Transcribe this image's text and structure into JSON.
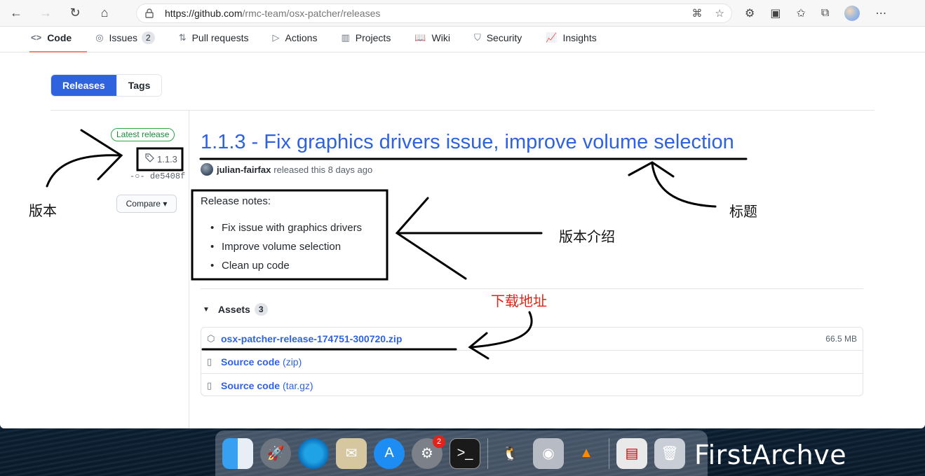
{
  "browser": {
    "url_host": "https://github.com",
    "url_path": "/rmc-team/osx-patcher/releases"
  },
  "repo_nav": [
    {
      "label": "Code",
      "icon": "code-icon",
      "glyph": "<>",
      "active": true
    },
    {
      "label": "Issues",
      "icon": "issue-icon",
      "glyph": "◎",
      "count": "2"
    },
    {
      "label": "Pull requests",
      "icon": "pull-request-icon",
      "glyph": "⇅"
    },
    {
      "label": "Actions",
      "icon": "play-icon",
      "glyph": "▷"
    },
    {
      "label": "Projects",
      "icon": "project-icon",
      "glyph": "▥"
    },
    {
      "label": "Wiki",
      "icon": "book-icon",
      "glyph": "📖"
    },
    {
      "label": "Security",
      "icon": "shield-icon",
      "glyph": "⛉"
    },
    {
      "label": "Insights",
      "icon": "graph-icon",
      "glyph": "📈"
    }
  ],
  "subnav": {
    "releases": "Releases",
    "tags": "Tags"
  },
  "sidebar": {
    "latest_label": "Latest release",
    "tag": "1.1.3",
    "commit": "de5408f",
    "compare": "Compare"
  },
  "release": {
    "title": "1.1.3 - Fix graphics drivers issue, improve volume selection",
    "author": "julian-fairfax",
    "released_text": "released this 8 days ago",
    "notes_heading": "Release notes:",
    "notes": [
      "Fix issue with graphics drivers",
      "Improve volume selection",
      "Clean up code"
    ]
  },
  "assets": {
    "label": "Assets",
    "count": "3",
    "items": [
      {
        "name": "osx-patcher-release-174751-300720.zip",
        "suffix": "",
        "size": "66.5 MB",
        "icon": "package-icon",
        "glyph": "⬡"
      },
      {
        "name": "Source code",
        "suffix": "(zip)",
        "size": "",
        "icon": "file-zip-icon",
        "glyph": "▯"
      },
      {
        "name": "Source code",
        "suffix": "(tar.gz)",
        "size": "",
        "icon": "file-zip-icon",
        "glyph": "▯"
      }
    ]
  },
  "annotations": {
    "version": "版本",
    "title": "标题",
    "intro": "版本介绍",
    "download": "下载地址"
  },
  "dock": {
    "settings_badge": "2",
    "watermark": "FirstArchve"
  },
  "colors": {
    "link": "#2f62de",
    "active_tab": "#f9826c",
    "annotation_red": "#e0241a"
  }
}
